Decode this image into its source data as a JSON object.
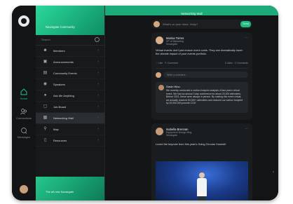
{
  "app": {
    "community_name": "Novargate Community",
    "footer_name": "The all-new Novargate",
    "topbar_title": "Networking Wall"
  },
  "rail": {
    "items": [
      {
        "label": "Home",
        "icon": "home-icon",
        "active": true
      },
      {
        "label": "Connections",
        "icon": "connections-icon",
        "active": false
      },
      {
        "label": "Messages",
        "icon": "messages-icon",
        "active": false
      }
    ]
  },
  "sidebar": {
    "search_placeholder": "Search",
    "items": [
      {
        "label": "Members",
        "icon": "members-icon"
      },
      {
        "label": "Announcements",
        "icon": "announcements-icon"
      },
      {
        "label": "Community Events",
        "icon": "calendar-icon"
      },
      {
        "label": "Speakers",
        "icon": "speakers-icon"
      },
      {
        "label": "Ask Me Anything",
        "icon": "ama-icon"
      },
      {
        "label": "Job Board",
        "icon": "job-board-icon"
      },
      {
        "label": "Networking Wall",
        "icon": "networking-icon",
        "active": true
      },
      {
        "label": "Map",
        "icon": "map-icon"
      },
      {
        "label": "Resources",
        "icon": "resources-icon"
      }
    ]
  },
  "composer": {
    "placeholder": "What's on your mind, Vicky?",
    "send_label": "Send"
  },
  "posts": [
    {
      "author": "Marisa Torres",
      "role": "VP of Marketing",
      "company": "Novargate",
      "text": "Virtual events don't just reduce event costs. They can dramatically lower the climate impact of your events portfolio.",
      "likes": "Like",
      "comments_label": "Comment",
      "stats_left": "5 Likes",
      "stats_right": "2 Comments",
      "comment_placeholder": "Write a comment...",
      "reply": {
        "author": "Gavin Wou",
        "text": "We recently conducted a carbon footprint analysis of last year's virtual event. We had an annual 3 day conference for about 20,000 attendees. Before 2021, these were always in person. By making this event virtual, we actually reached 50,000+ attendees and reduced our carbon footprint by 20,000,000 pounds CO2!"
      }
    },
    {
      "author": "Isabella Brennan",
      "role": "Equipment Design Mng",
      "company": "Novargate",
      "text": "Loved the keynote from this year's Going Circular Summit!"
    }
  ]
}
